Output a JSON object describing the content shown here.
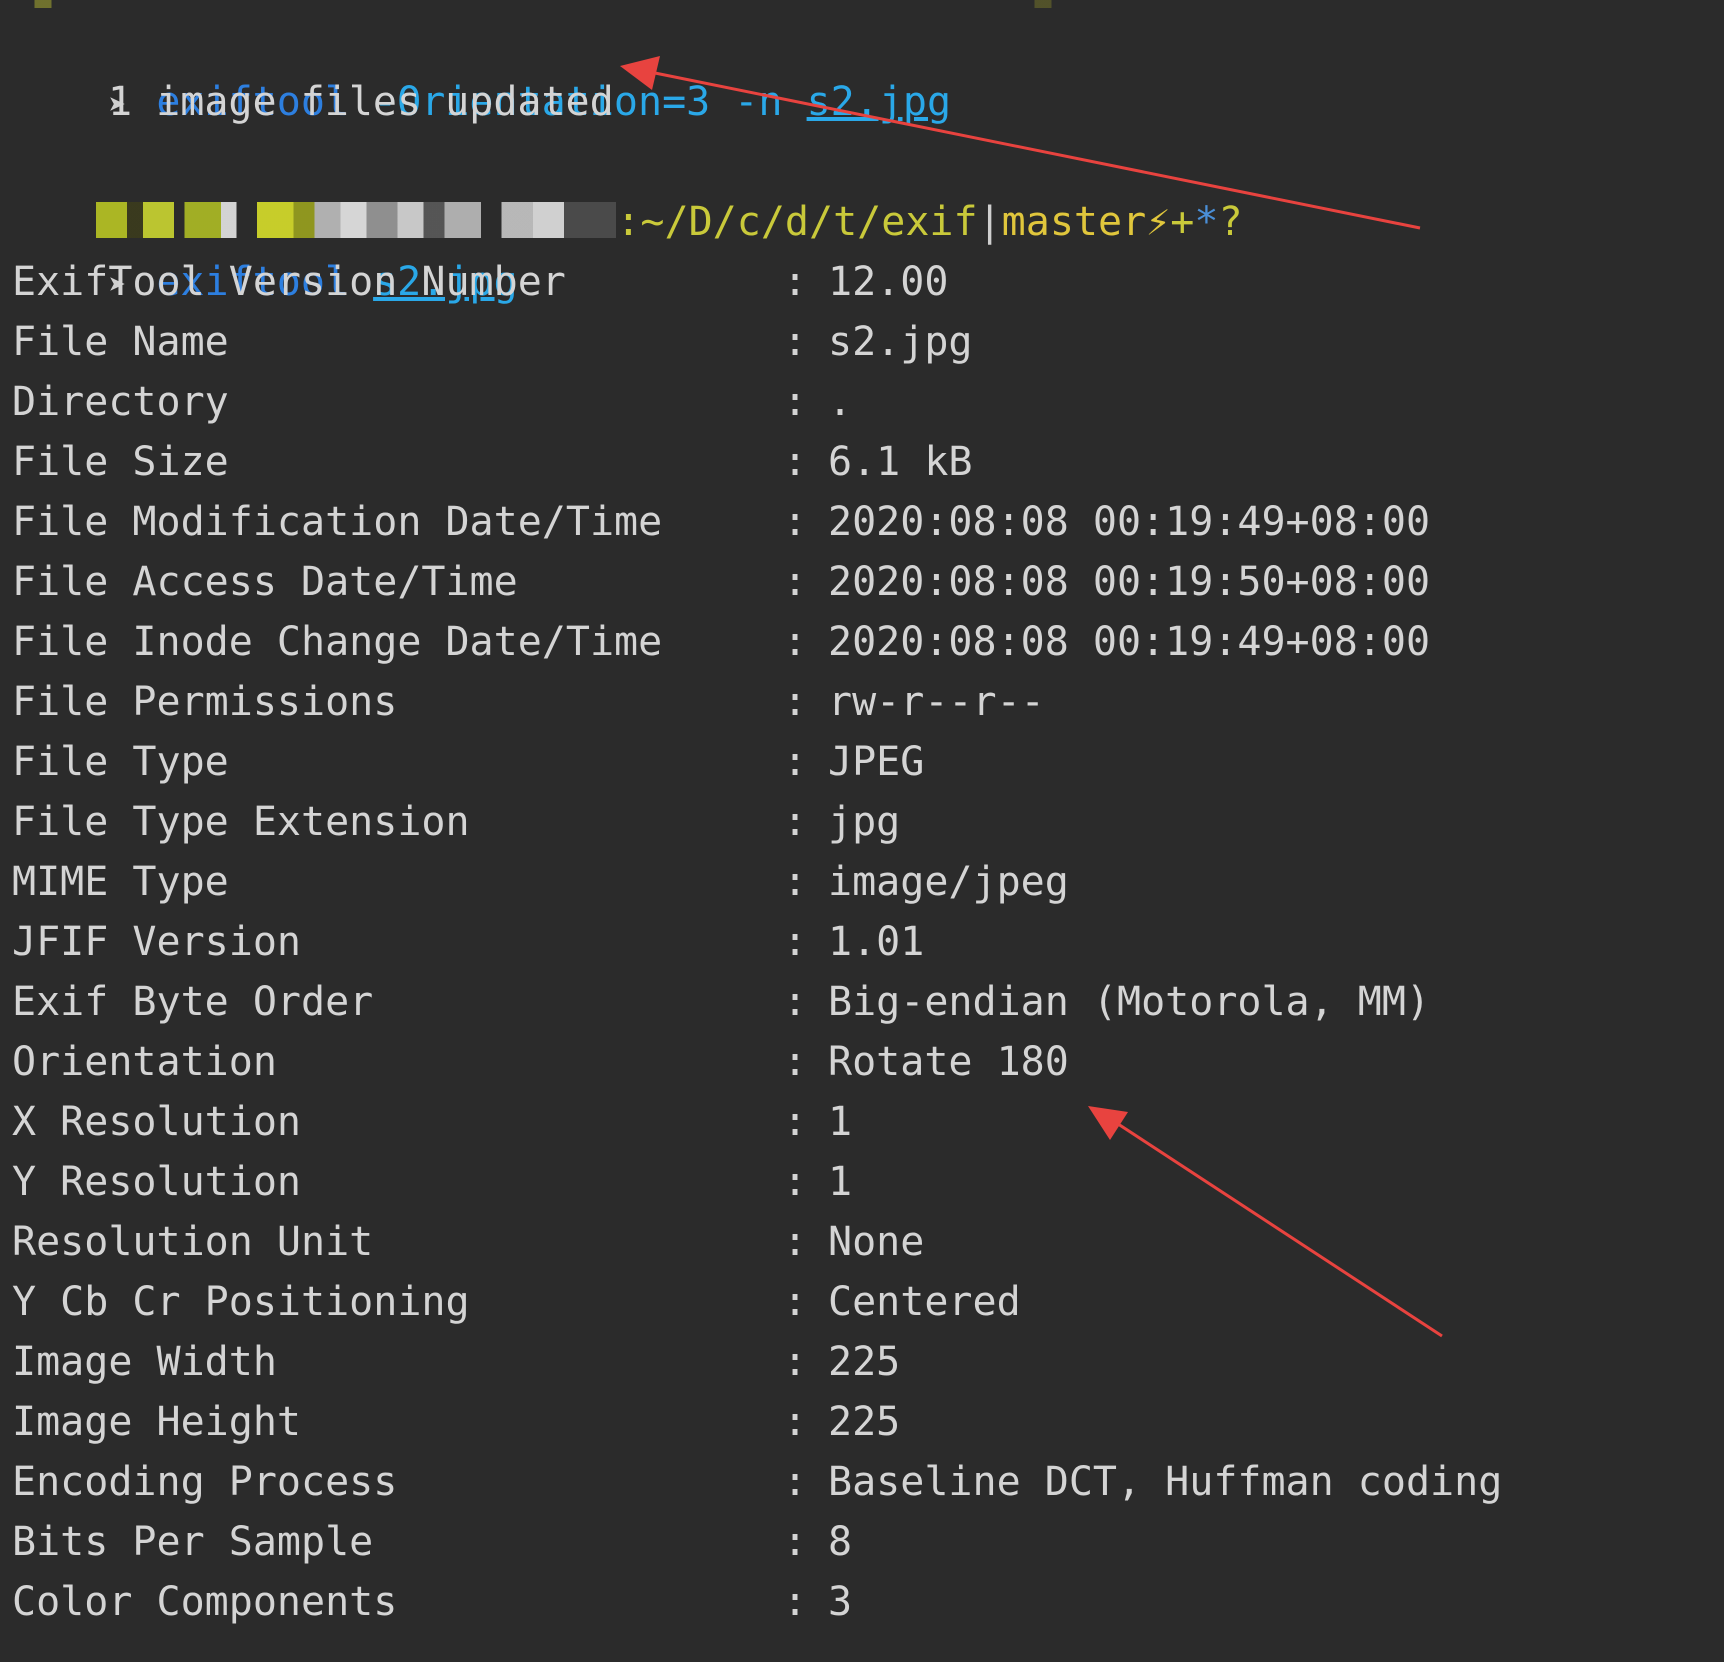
{
  "colors": {
    "background": "#2b2b2b",
    "command": "#2d7fe0",
    "argument": "#2aa8e8",
    "text": "#d4d4d4",
    "path": "#c9c93a",
    "branch": "#e0c63c",
    "annotation_arrow": "#e8433f"
  },
  "terminal": {
    "cmd1": {
      "prompt_glyph": "➤",
      "command": "exiftool",
      "args": "-Orientation=3 -n",
      "file": "s2.jpg"
    },
    "cmd1_output": "1 image files updated",
    "prompt_line": {
      "user_host_redacted": "",
      "partial_text": "Pro",
      "path": ":~/D/c/d/t/exif",
      "separator": "|",
      "branch": "master",
      "flag_icon": "⚡",
      "staged": "+",
      "dirty": "*",
      "untracked": "?"
    },
    "cmd2": {
      "prompt_glyph": "➤",
      "command": "exiftool",
      "file": "s2.jpg"
    },
    "separator_char": ":",
    "rows": [
      {
        "key": "ExifTool Version Number",
        "value": "12.00"
      },
      {
        "key": "File Name",
        "value": "s2.jpg"
      },
      {
        "key": "Directory",
        "value": "."
      },
      {
        "key": "File Size",
        "value": "6.1 kB"
      },
      {
        "key": "File Modification Date/Time",
        "value": "2020:08:08 00:19:49+08:00"
      },
      {
        "key": "File Access Date/Time",
        "value": "2020:08:08 00:19:50+08:00"
      },
      {
        "key": "File Inode Change Date/Time",
        "value": "2020:08:08 00:19:49+08:00"
      },
      {
        "key": "File Permissions",
        "value": "rw-r--r--"
      },
      {
        "key": "File Type",
        "value": "JPEG"
      },
      {
        "key": "File Type Extension",
        "value": "jpg"
      },
      {
        "key": "MIME Type",
        "value": "image/jpeg"
      },
      {
        "key": "JFIF Version",
        "value": "1.01"
      },
      {
        "key": "Exif Byte Order",
        "value": "Big-endian (Motorola, MM)"
      },
      {
        "key": "Orientation",
        "value": "Rotate 180"
      },
      {
        "key": "X Resolution",
        "value": "1"
      },
      {
        "key": "Y Resolution",
        "value": "1"
      },
      {
        "key": "Resolution Unit",
        "value": "None"
      },
      {
        "key": "Y Cb Cr Positioning",
        "value": "Centered"
      },
      {
        "key": "Image Width",
        "value": "225"
      },
      {
        "key": "Image Height",
        "value": "225"
      },
      {
        "key": "Encoding Process",
        "value": "Baseline DCT, Huffman coding"
      },
      {
        "key": "Bits Per Sample",
        "value": "8"
      },
      {
        "key": "Color Components",
        "value": "3"
      }
    ]
  }
}
